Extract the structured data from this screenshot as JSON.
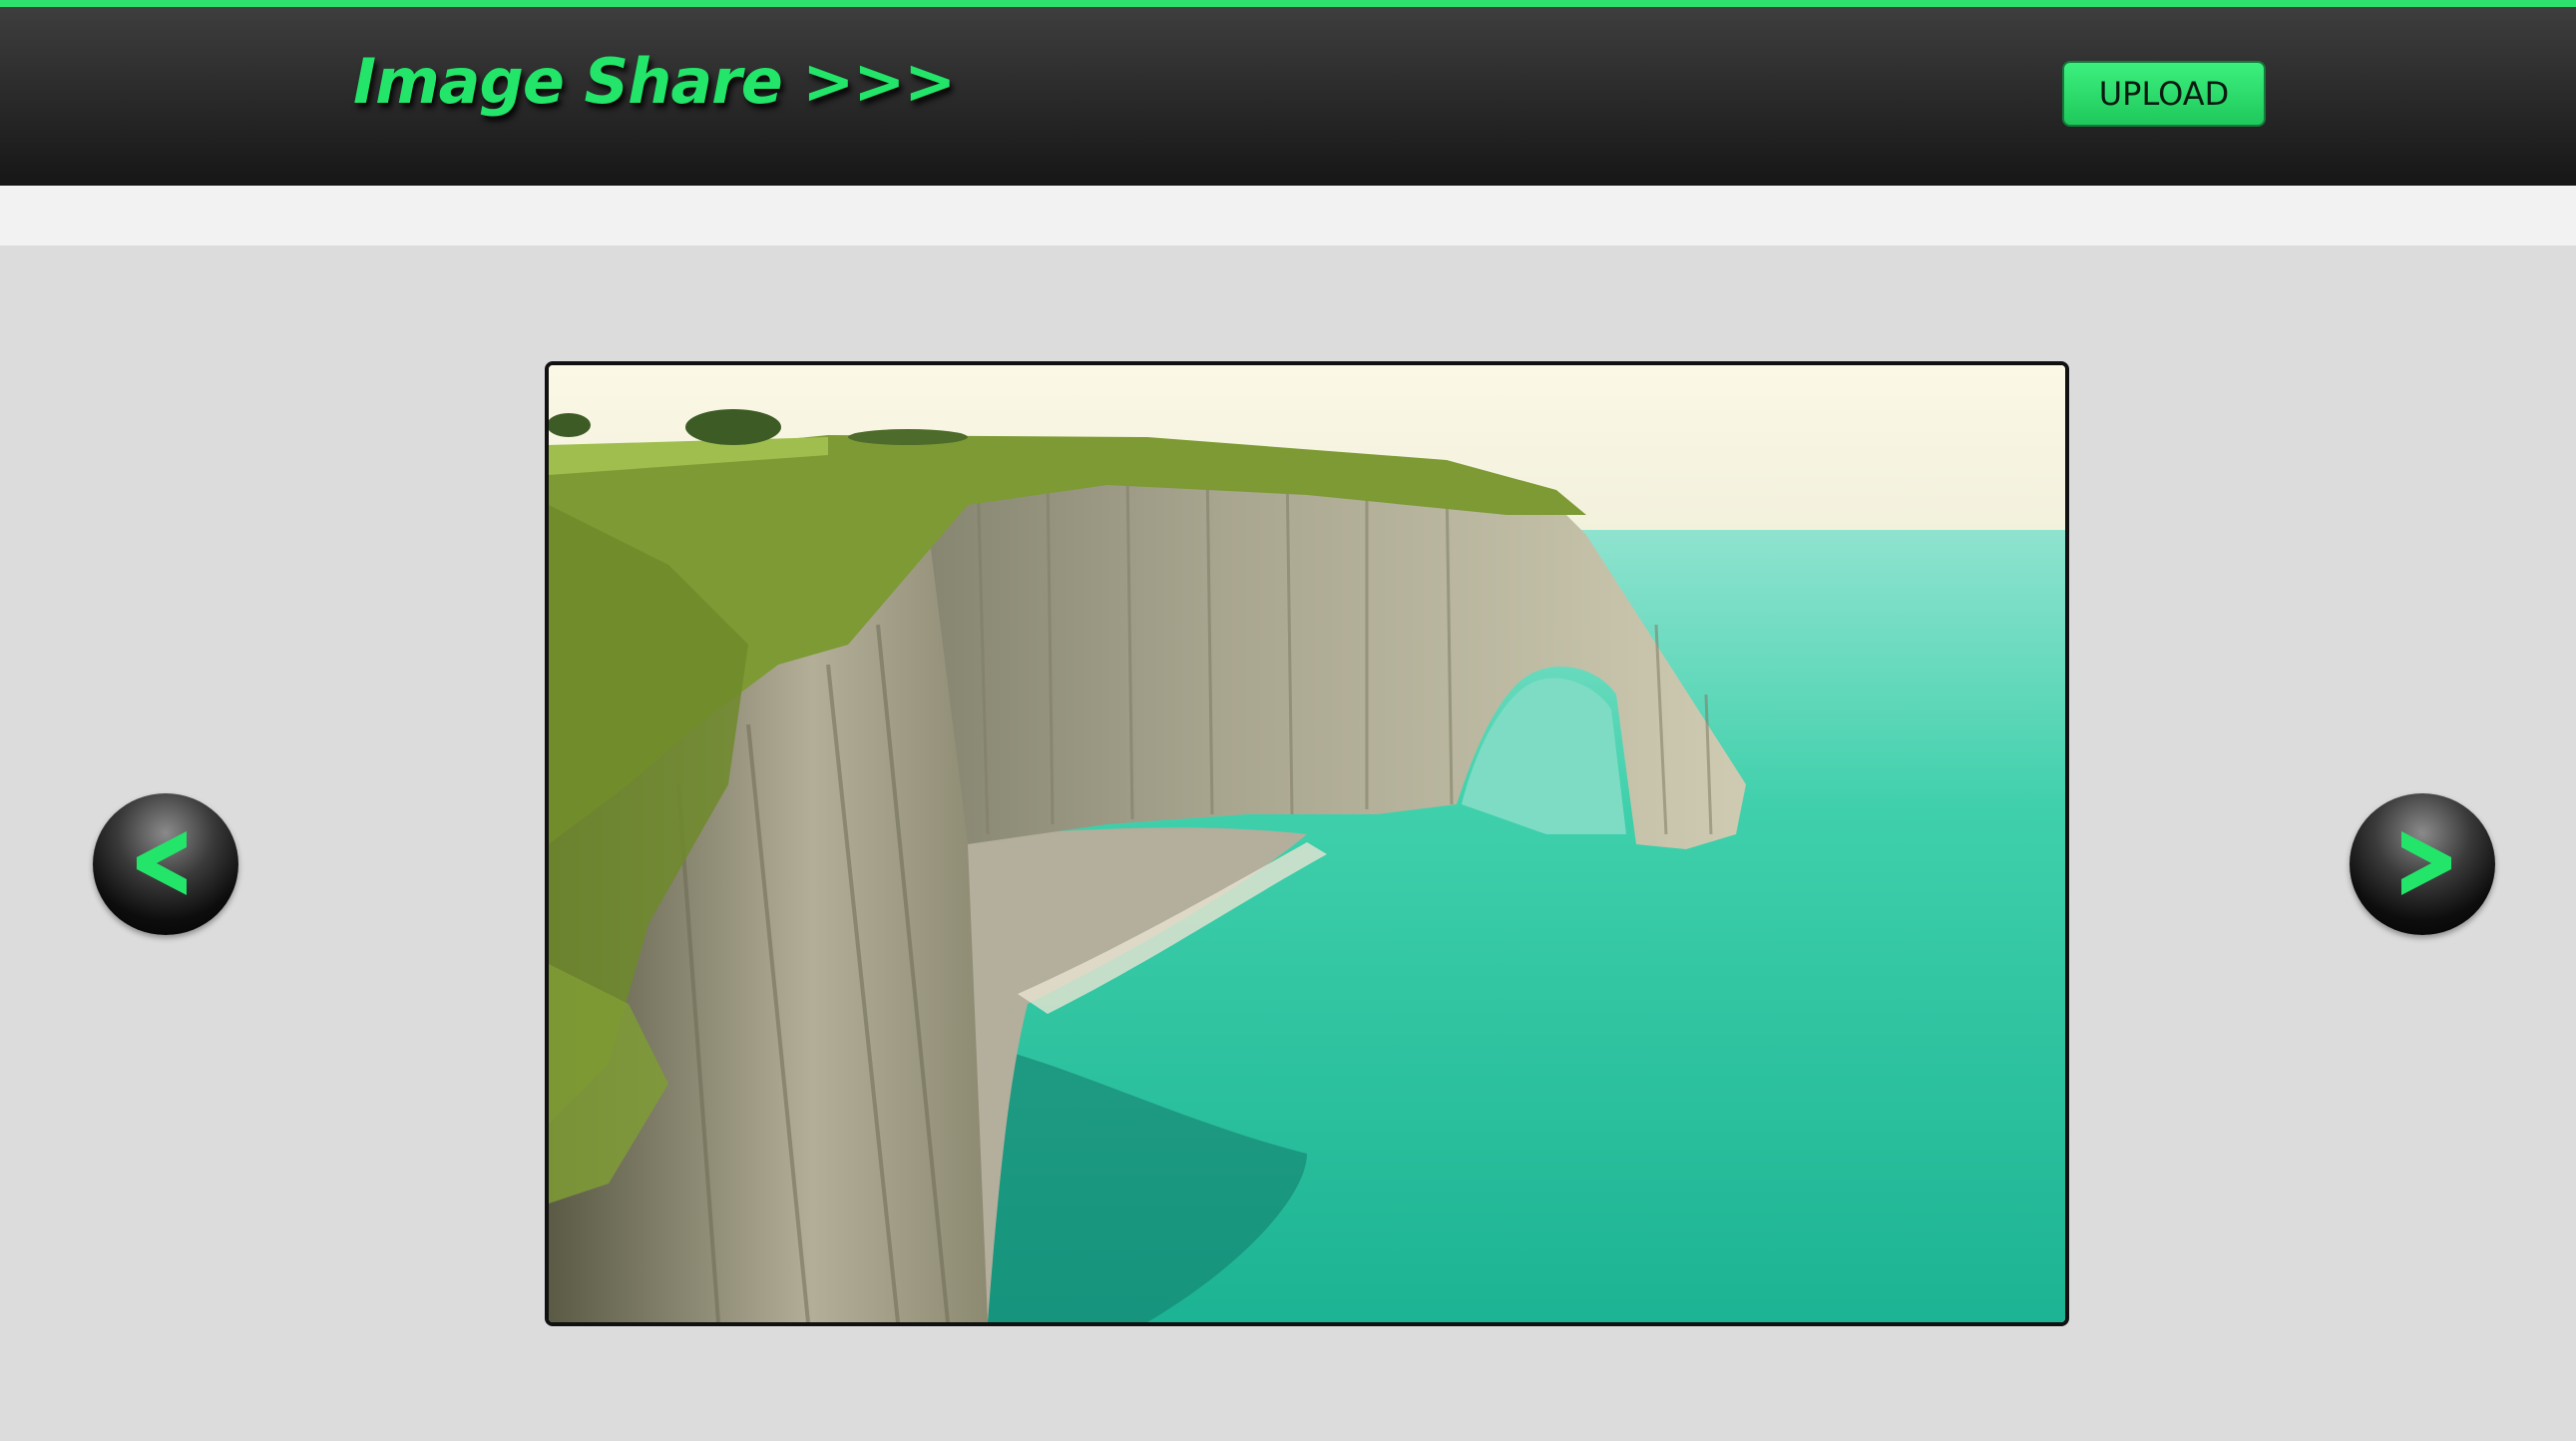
{
  "header": {
    "logo_text": "Image Share >>>",
    "upload_label": "UPLOAD"
  },
  "colors": {
    "accent": "#22e56a",
    "header_bg": "#1e1e1e",
    "page_bg": "#dcdcdc",
    "subbar_bg": "#f2f2f2"
  },
  "viewer": {
    "image_subject": "White chalk sea cliffs with a natural arch over turquoise water",
    "prev_icon": "chevron-left-icon",
    "next_icon": "chevron-right-icon"
  }
}
